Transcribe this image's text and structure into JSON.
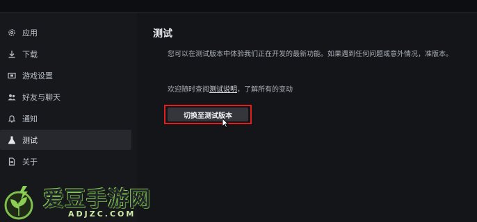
{
  "sidebar": {
    "items": [
      {
        "label": "应用",
        "icon": "gear-icon"
      },
      {
        "label": "下载",
        "icon": "download-icon"
      },
      {
        "label": "游戏设置",
        "icon": "game-settings-icon"
      },
      {
        "label": "好友与聊天",
        "icon": "friends-icon"
      },
      {
        "label": "通知",
        "icon": "bell-icon"
      },
      {
        "label": "测试",
        "icon": "flask-icon",
        "active": true
      },
      {
        "label": "关于",
        "icon": "document-icon"
      }
    ]
  },
  "main": {
    "title": "测试",
    "description": "您可以在测试版本中体验我们正在开发的最新功能。如果遇到任何问题或意外情况，准版本。",
    "invite_prefix": "欢迎随时查阅",
    "invite_link": "测试说明",
    "invite_suffix": "，了解所有的变动",
    "switch_button": "切换至测试版本"
  },
  "watermark": {
    "text": "爱豆手游网",
    "url": "ADJZC.COM"
  },
  "colors": {
    "background": "#141519",
    "sidebar": "#17181c",
    "highlight_border": "#e02020",
    "button": "#34363c"
  }
}
